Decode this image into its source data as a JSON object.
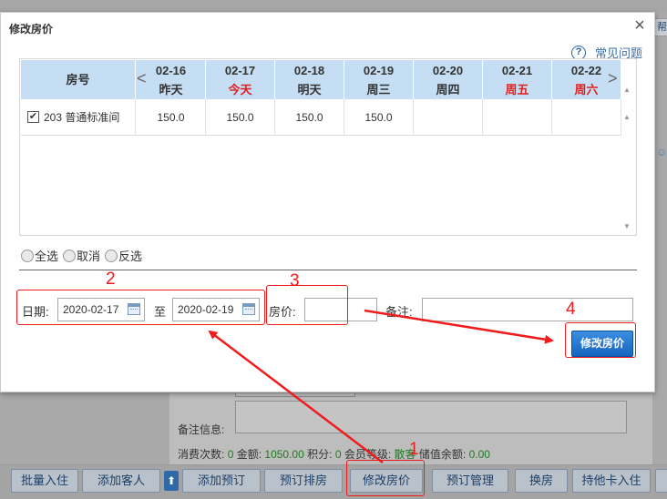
{
  "dialog": {
    "title": "修改房价",
    "close_symbol": "×",
    "faq_label": "常见问题",
    "faq_icon": "question-circle-icon"
  },
  "grid": {
    "room_header": "房号",
    "prev_symbol": "<",
    "next_symbol": ">",
    "days": [
      {
        "date": "02-16",
        "label": "昨天",
        "highlight": false
      },
      {
        "date": "02-17",
        "label": "今天",
        "highlight": true
      },
      {
        "date": "02-18",
        "label": "明天",
        "highlight": false
      },
      {
        "date": "02-19",
        "label": "周三",
        "highlight": false
      },
      {
        "date": "02-20",
        "label": "周四",
        "highlight": false
      },
      {
        "date": "02-21",
        "label": "周五",
        "highlight": true
      },
      {
        "date": "02-22",
        "label": "周六",
        "highlight": true
      }
    ],
    "rows": [
      {
        "room": "203 普通标准间",
        "checked": true,
        "check_symbol": "✔",
        "prices": [
          "150.0",
          "150.0",
          "150.0",
          "150.0",
          "",
          "",
          ""
        ]
      }
    ]
  },
  "selection": {
    "select_all": "全选",
    "cancel": "取消",
    "invert": "反选"
  },
  "form": {
    "date_label": "日期:",
    "start_date": "2020-02-17",
    "to_label": "至",
    "end_date": "2020-02-19",
    "price_label": "房价:",
    "price_value": "",
    "note_label": "备注:",
    "note_value": "",
    "submit_label": "修改房价"
  },
  "background": {
    "note_info_label": "备注信息:",
    "stats": {
      "consume_label": "消费次数:",
      "consume_value": "0",
      "amount_label": "金额:",
      "amount_value": "1050.00",
      "points_label": "积分:",
      "points_value": "0",
      "level_label": "会员等级:",
      "level_value": "散客",
      "balance_label": "储值余额:",
      "balance_value": "0.00"
    },
    "buttons": [
      "批量入住",
      "添加客人",
      "添加预订",
      "预订排房",
      "修改房价",
      "预订管理",
      "换房",
      "持他卡入住"
    ],
    "up_arrow": "⬆",
    "edge_tab": "帮"
  },
  "annotations": [
    "1",
    "2",
    "3",
    "4"
  ],
  "colors": {
    "accent_blue": "#1565c0",
    "header_blue": "#c5def3",
    "highlight_red": "#e02020",
    "annotation_red": "#f01c1c",
    "stats_green": "#217a21"
  }
}
